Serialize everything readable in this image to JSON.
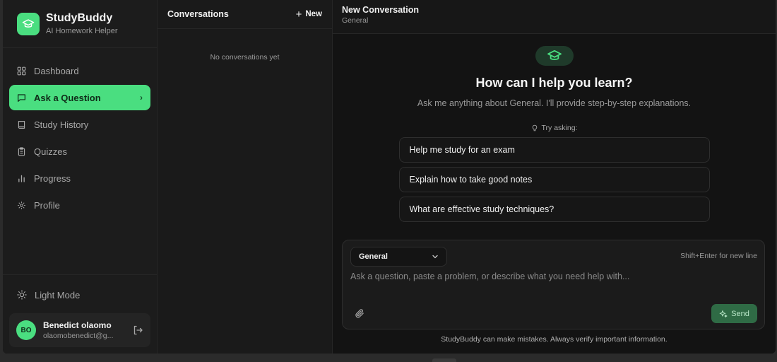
{
  "brand": {
    "name": "StudyBuddy",
    "subtitle": "AI Homework Helper",
    "icon": "graduation-cap-icon"
  },
  "nav": {
    "items": [
      {
        "label": "Dashboard",
        "icon": "grid-icon"
      },
      {
        "label": "Ask a Question",
        "icon": "chat-icon",
        "active": true
      },
      {
        "label": "Study History",
        "icon": "book-icon"
      },
      {
        "label": "Quizzes",
        "icon": "clipboard-icon"
      },
      {
        "label": "Progress",
        "icon": "bar-chart-icon"
      },
      {
        "label": "Profile",
        "icon": "gear-icon"
      }
    ]
  },
  "theme_toggle": {
    "label": "Light Mode",
    "icon": "sun-icon"
  },
  "user": {
    "initials": "BO",
    "name": "Benedict olaomo",
    "email": "olaomobenedict@g..."
  },
  "conversations": {
    "title": "Conversations",
    "new_label": "New",
    "empty_text": "No conversations yet"
  },
  "header": {
    "title": "New Conversation",
    "subtitle": "General"
  },
  "welcome": {
    "title": "How can I help you learn?",
    "subtitle": "Ask me anything about General. I'll provide step-by-step explanations.",
    "try_label": "Try asking:",
    "suggestions": [
      "Help me study for an exam",
      "Explain how to take good notes",
      "What are effective study techniques?"
    ]
  },
  "composer": {
    "subject": "General",
    "hint": "Shift+Enter for new line",
    "placeholder": "Ask a question, paste a problem, or describe what you need help with...",
    "send_label": "Send"
  },
  "disclaimer": "StudyBuddy can make mistakes. Always verify important information.",
  "colors": {
    "accent": "#4ade80",
    "background": "#141414",
    "sidebar": "#1c1c1c",
    "send_button": "#2f6b45"
  }
}
